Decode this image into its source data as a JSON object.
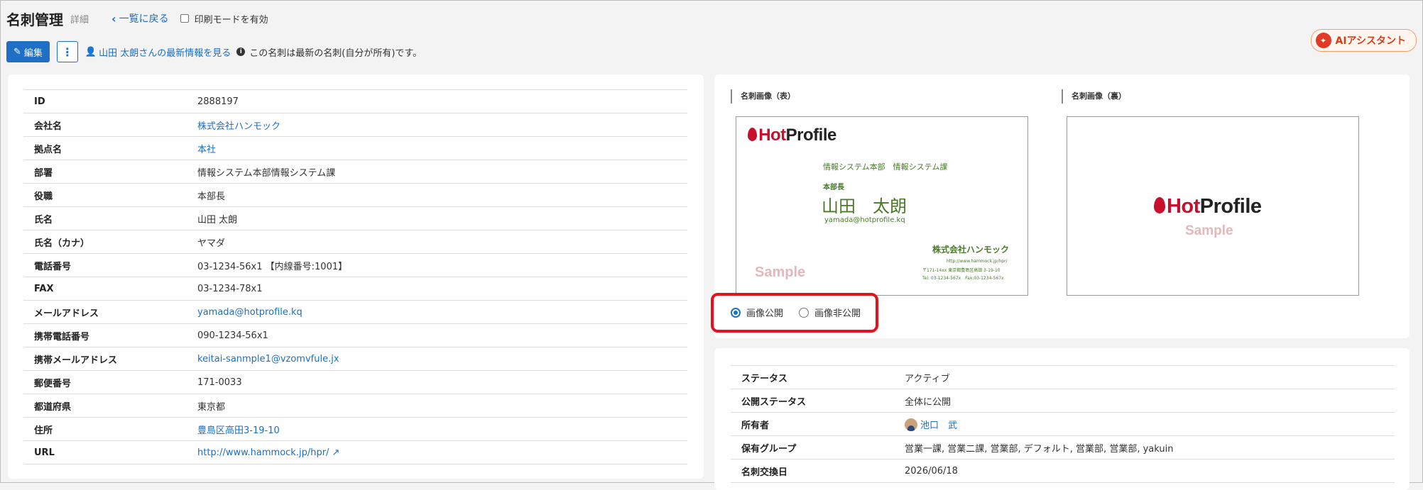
{
  "header": {
    "title": "名刺管理",
    "subtitle": "詳細",
    "back_label": "一覧に戻る",
    "print_label": "印刷モードを有効"
  },
  "toolbar": {
    "edit_label": "編集",
    "more_label": "⋮",
    "latest_link": "山田 太朗さんの最新情報を見る",
    "note": "この名刺は最新の名刺(自分が所有)です。"
  },
  "ai_button": {
    "label": "AIアシスタント"
  },
  "details": [
    {
      "label": "ID",
      "value": "2888197",
      "link": false
    },
    {
      "label": "会社名",
      "value": "株式会社ハンモック",
      "link": true
    },
    {
      "label": "拠点名",
      "value": "本社",
      "link": true
    },
    {
      "label": "部署",
      "value": "情報システム本部情報システム課",
      "link": false
    },
    {
      "label": "役職",
      "value": "本部長",
      "link": false
    },
    {
      "label": "氏名",
      "value": "山田 太朗",
      "link": false
    },
    {
      "label": "氏名（カナ）",
      "value": "ヤマダ",
      "link": false
    },
    {
      "label": "電話番号",
      "value": "03-1234-56x1 【内線番号:1001】",
      "link": false
    },
    {
      "label": "FAX",
      "value": "03-1234-78x1",
      "link": false
    },
    {
      "label": "メールアドレス",
      "value": "yamada@hotprofile.kq",
      "link": true
    },
    {
      "label": "携帯電話番号",
      "value": "090-1234-56x1",
      "link": false
    },
    {
      "label": "携帯メールアドレス",
      "value": "keitai-sanmple1@vzomvfule.jx",
      "link": true
    },
    {
      "label": "郵便番号",
      "value": "171-0033",
      "link": false
    },
    {
      "label": "都道府県",
      "value": "東京都",
      "link": false
    },
    {
      "label": "住所",
      "value": "豊島区高田3-19-10",
      "link": true
    },
    {
      "label": "URL",
      "value": "http://www.hammock.jp/hpr/",
      "link": true
    }
  ],
  "images": {
    "front_label": "名刺画像（表）",
    "back_label": "名刺画像（裏）",
    "logo_hot": "Hot",
    "logo_profile": "Profile",
    "sample": "Sample",
    "front_card": {
      "dept": "情報システム本部　情報システム課",
      "title": "本部長",
      "name": "山田　太朗",
      "email": "yamada@hotprofile.kq",
      "company": "株式会社ハンモック",
      "url": "http://www.hammock.jp/hpr/",
      "address": "〒171-14xx 東京都豊島区高田 3-19-10",
      "tel": "Tel: 03-1234-567x　Fax:03-1234-567x"
    }
  },
  "visibility": {
    "public_label": "画像公開",
    "private_label": "画像非公開",
    "selected": "画像公開"
  },
  "status_rows": [
    {
      "label": "ステータス",
      "value": "アクティブ"
    },
    {
      "label": "公開ステータス",
      "value": "全体に公開"
    },
    {
      "label": "所有者",
      "value": "池口　武"
    },
    {
      "label": "保有グループ",
      "value": "営業一課, 営業二課, 営業部, デフォルト, 営業部, 営業部, yakuin"
    },
    {
      "label": "名刺交換日",
      "value": "2026/06/18"
    }
  ],
  "colors": {
    "accent": "#1e6fc5",
    "link": "#1a6fc4",
    "highlight": "#e1141d",
    "brand_red": "#c8102e"
  }
}
